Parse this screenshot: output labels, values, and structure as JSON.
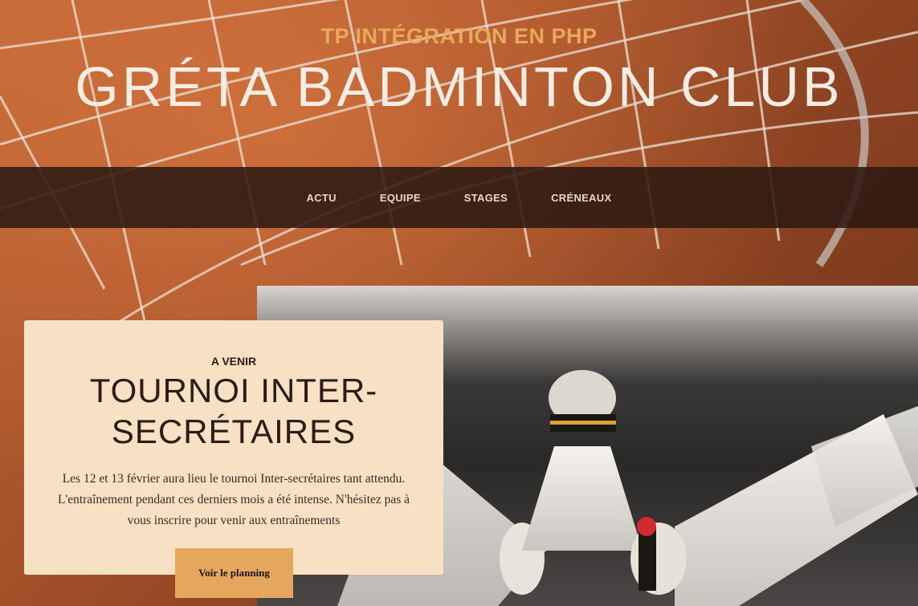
{
  "header": {
    "subtitle": "TP INTÉGRATION EN PHP",
    "title": "GRÉTA BADMINTON CLUB"
  },
  "nav": {
    "items": [
      {
        "label": "ACTU"
      },
      {
        "label": "EQUIPE"
      },
      {
        "label": "STAGES"
      },
      {
        "label": "CRÉNEAUX"
      }
    ]
  },
  "feature": {
    "label": "A VENIR",
    "title": "TOURNOI INTER-SECRÉTAIRES",
    "text": "Les 12 et 13 février aura lieu le tournoi Inter-secrétaires tant attendu. L'entraînement pendant ces derniers mois a été intense. N'hésitez pas à vous inscrire pour venir aux entraînements",
    "button_label": "Voir le planning"
  }
}
